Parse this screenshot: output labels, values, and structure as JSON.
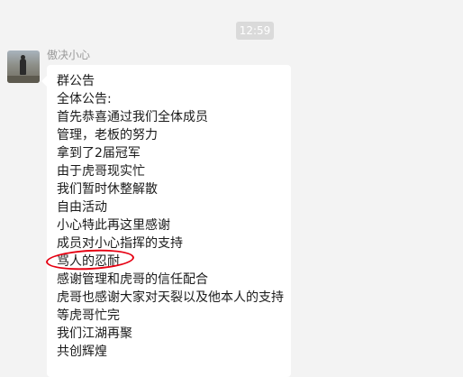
{
  "chat": {
    "timestamp": "12:59",
    "message": {
      "sender": "傲决小心",
      "lines": [
        "群公告",
        "全体公告:",
        "首先恭喜通过我们全体成员",
        "管理，老板的努力",
        "拿到了2届冠军",
        "由于虎哥现实忙",
        "我们暂时休整解散",
        "自由活动",
        "小心特此再这里感谢",
        "成员对小心指挥的支持",
        "骂人的忍耐",
        "感谢管理和虎哥的信任配合",
        "虎哥也感谢大家对天裂以及他本人的支持",
        "等虎哥忙完",
        "我们江湖再聚",
        "共创辉煌"
      ]
    }
  },
  "colors": {
    "background": "#f3f3f3",
    "bubble": "#ffffff",
    "highlight_circle": "#e60012"
  }
}
